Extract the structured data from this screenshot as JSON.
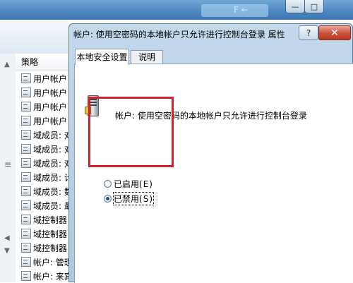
{
  "bg_window": {
    "title_fragment": "",
    "glow_text": "F ←",
    "min_symbol": "—",
    "max_symbol": "□"
  },
  "policy_list": {
    "header": "策略",
    "items": [
      "用户帐户",
      "用户帐户",
      "用户帐户",
      "用户帐户",
      "域成员: 对",
      "域成员: 对",
      "域成员: 对",
      "域成员: 计",
      "域成员: 数",
      "域成员: 最",
      "域控制器",
      "域控制器",
      "域控制器",
      "帐户: 管理",
      "帐户: 来宾"
    ]
  },
  "dialog": {
    "title": "帐户: 使用空密码的本地帐户只允许进行控制台登录 属性",
    "help_symbol": "?",
    "close_symbol": "✕",
    "tabs": [
      {
        "label": "本地安全设置",
        "active": true
      },
      {
        "label": "说明",
        "active": false
      }
    ],
    "policy_name": "帐户: 使用空密码的本地帐户只允许进行控制台登录",
    "options": [
      {
        "label": "已启用",
        "hotkey": "(E)",
        "checked": false
      },
      {
        "label": "已禁用",
        "hotkey": "(S)",
        "checked": true
      }
    ]
  },
  "annotation_color": "#d2232a"
}
